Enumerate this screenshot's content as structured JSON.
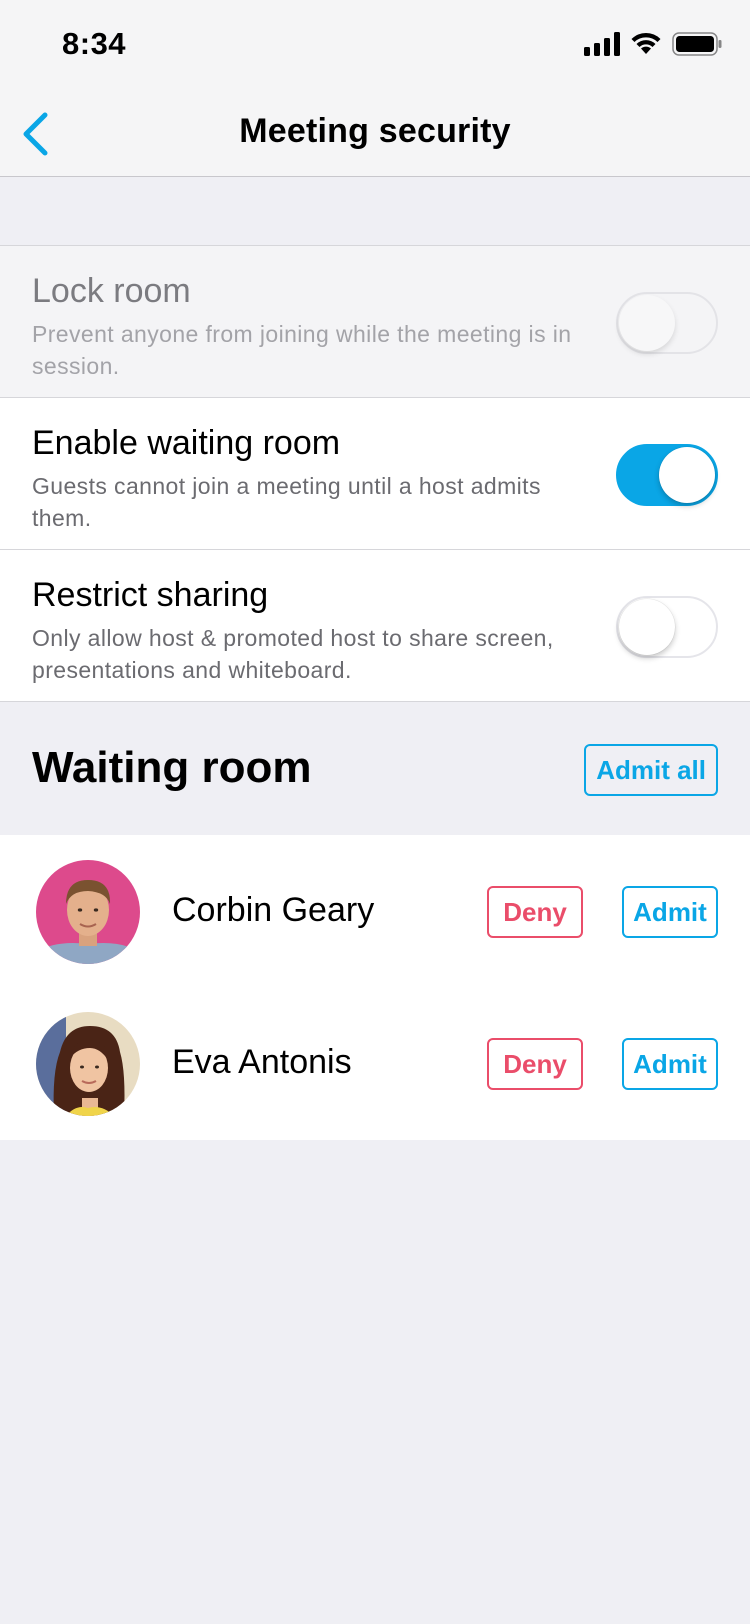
{
  "status_bar": {
    "time": "8:34"
  },
  "nav": {
    "title": "Meeting security"
  },
  "settings": [
    {
      "title": "Lock room",
      "description": "Prevent anyone from joining while the meeting is in session.",
      "enabled": false,
      "disabled": true
    },
    {
      "title": "Enable waiting room",
      "description": "Guests cannot join a meeting until a host admits them.",
      "enabled": true,
      "disabled": false
    },
    {
      "title": "Restrict sharing",
      "description": "Only allow host & promoted host to share screen, presentations and whiteboard.",
      "enabled": false,
      "disabled": false
    }
  ],
  "waiting_room": {
    "title": "Waiting room",
    "admit_all_label": "Admit all",
    "people": [
      {
        "name": "Corbin Geary",
        "deny_label": "Deny",
        "admit_label": "Admit"
      },
      {
        "name": "Eva Antonis",
        "deny_label": "Deny",
        "admit_label": "Admit"
      }
    ]
  },
  "colors": {
    "accent": "#0aa6e6",
    "deny": "#ea4d6a",
    "background": "#efeff4"
  }
}
